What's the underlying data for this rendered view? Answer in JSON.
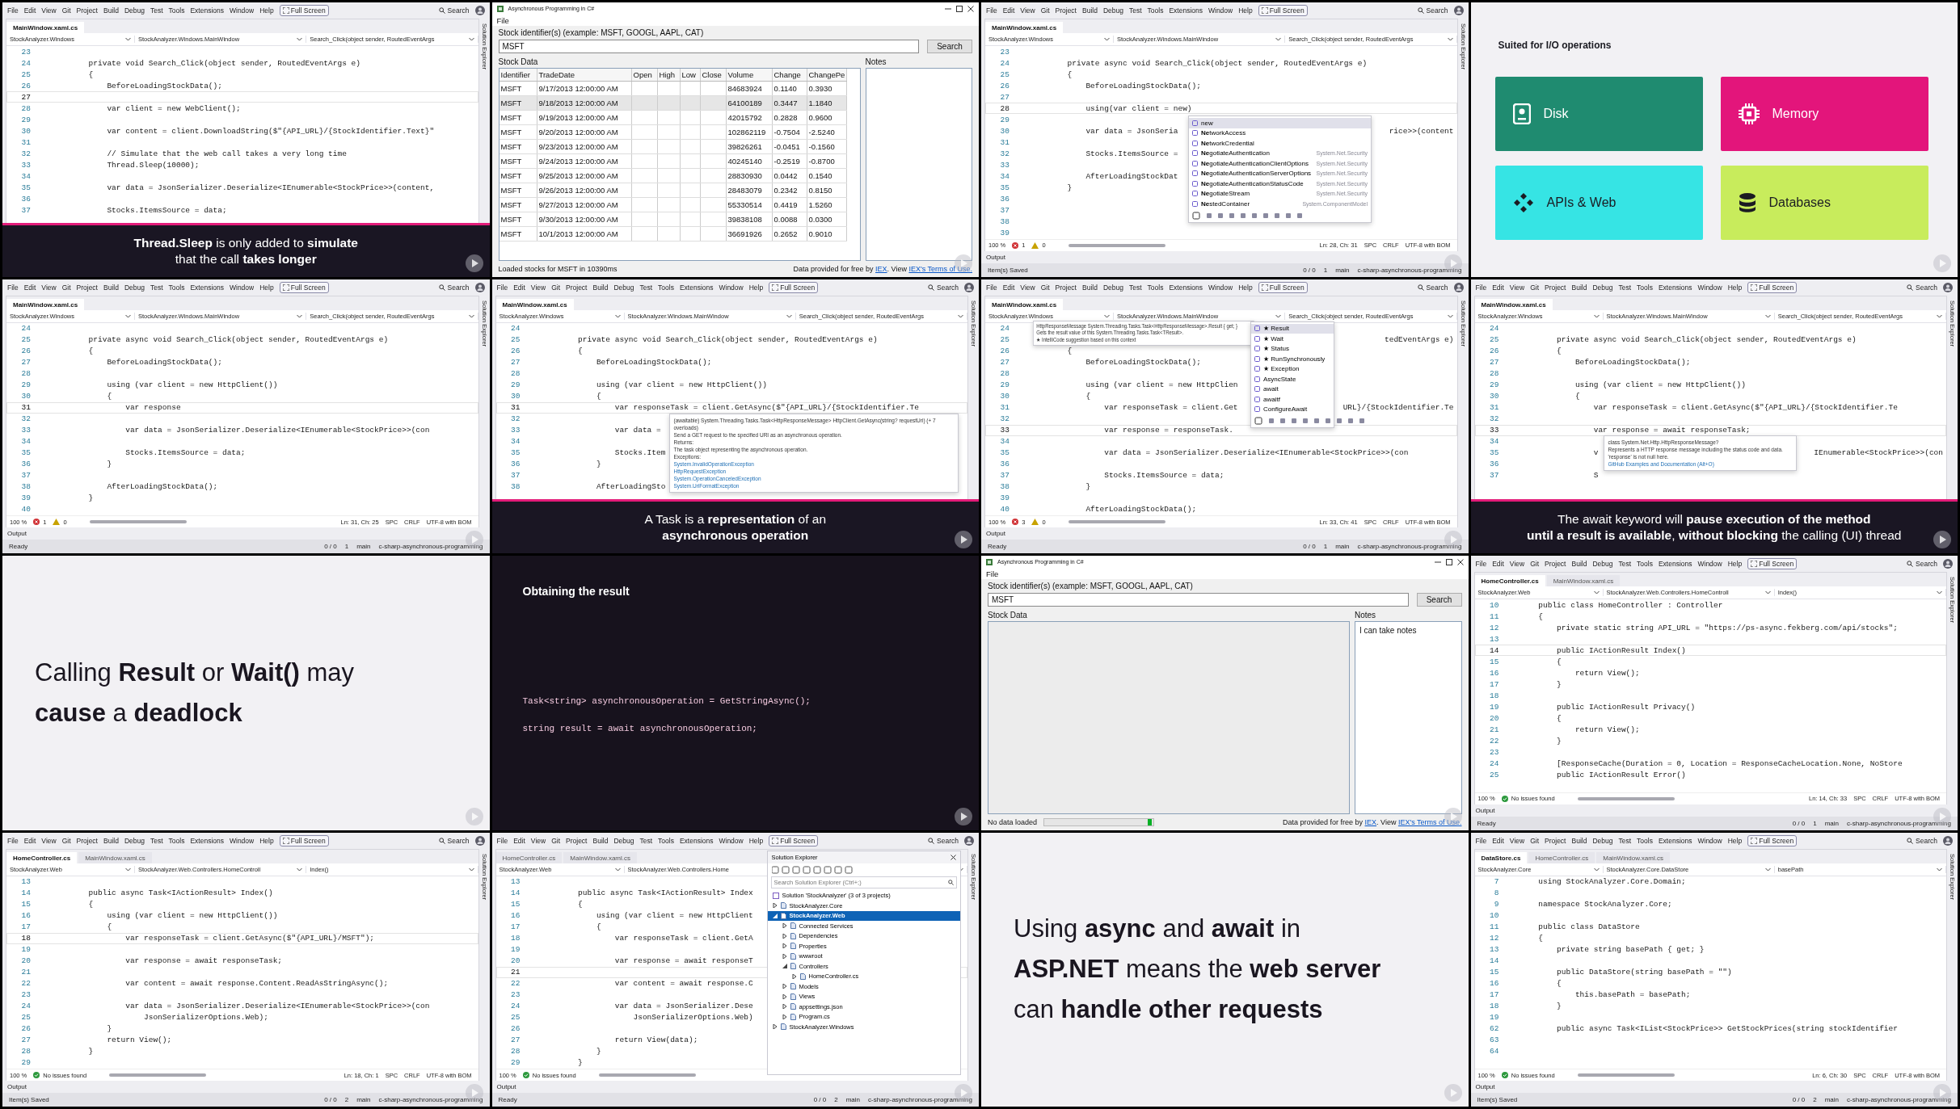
{
  "tiles": [
    {
      "kind": "ide",
      "menu": [
        "File",
        "Edit",
        "View",
        "Git",
        "Project",
        "Build",
        "Debug",
        "Test",
        "Tools",
        "Extensions",
        "Window",
        "Help"
      ],
      "fullscreen": "Full Screen",
      "search": "Search",
      "side_label": "Solution Explorer",
      "tabs": [
        {
          "label": "MainWindow.xaml.cs",
          "selected": true
        }
      ],
      "nav": [
        "StockAnalyzer.Windows",
        "StockAnalyzer.Windows.MainWindow",
        "Search_Click(object sender, RoutedEventArgs"
      ],
      "lines": [
        {
          "n": "23",
          "current": false
        },
        {
          "n": "24",
          "code": "        private void Search_Click(object sender, RoutedEventArgs e)",
          "current": false
        },
        {
          "n": "25",
          "code": "        {",
          "current": false
        },
        {
          "n": "26",
          "code": "            BeforeLoadingStockData();",
          "current": false
        },
        {
          "n": "27",
          "current": true
        },
        {
          "n": "28",
          "code": "            var client = new WebClient();",
          "current": false
        },
        {
          "n": "29",
          "current": false
        },
        {
          "n": "30",
          "code": "            var content = client.DownloadString($\"{API_URL}/{StockIdentifier.Text}\"",
          "current": false
        },
        {
          "n": "31",
          "current": false
        },
        {
          "n": "32",
          "code": "            // Simulate that the web call takes a very long time",
          "current": false
        },
        {
          "n": "33",
          "code": "            Thread.Sleep(10000);",
          "current": false
        },
        {
          "n": "34",
          "current": false
        },
        {
          "n": "35",
          "code": "            var data = JsonSerializer.Deserialize<IEnumerable<StockPrice>>(content,",
          "current": false
        },
        {
          "n": "36",
          "current": false
        },
        {
          "n": "37",
          "code": "            Stocks.ItemsSource = data;",
          "current": false
        }
      ],
      "caption": "**Thread.Sleep** is only added to **simulate**\nthat the call **takes longer**"
    },
    {
      "kind": "app",
      "title": "Asynchronous Programming in C#",
      "menu": "File",
      "prompt": "Stock identifier(s) (example: MSFT, GOOGL, AAPL, CAT)",
      "ticker": "MSFT",
      "search": "Search",
      "data_label": "Stock Data",
      "notes_label": "Notes",
      "columns": [
        "Identifier",
        "TradeDate",
        "Open",
        "High",
        "Low",
        "Close",
        "Volume",
        "Change",
        "ChangePe"
      ],
      "rows": [
        {
          "id": "MSFT",
          "date": "9/17/2013 12:00:00 AM",
          "volume": "84683924",
          "change": "0.1140",
          "pct": "0.3930",
          "selected": false
        },
        {
          "id": "MSFT",
          "date": "9/18/2013 12:00:00 AM",
          "volume": "64100189",
          "change": "0.3447",
          "pct": "1.1840",
          "selected": true
        },
        {
          "id": "MSFT",
          "date": "9/19/2013 12:00:00 AM",
          "volume": "42015792",
          "change": "0.2828",
          "pct": "0.9600",
          "selected": false
        },
        {
          "id": "MSFT",
          "date": "9/20/2013 12:00:00 AM",
          "volume": "102862119",
          "change": "-0.7504",
          "pct": "-2.5240",
          "selected": false
        },
        {
          "id": "MSFT",
          "date": "9/23/2013 12:00:00 AM",
          "volume": "39826261",
          "change": "-0.0451",
          "pct": "-0.1560",
          "selected": false
        },
        {
          "id": "MSFT",
          "date": "9/24/2013 12:00:00 AM",
          "volume": "40245140",
          "change": "-0.2519",
          "pct": "-0.8700",
          "selected": false
        },
        {
          "id": "MSFT",
          "date": "9/25/2013 12:00:00 AM",
          "volume": "28830930",
          "change": "0.0442",
          "pct": "0.1540",
          "selected": false
        },
        {
          "id": "MSFT",
          "date": "9/26/2013 12:00:00 AM",
          "volume": "28483079",
          "change": "0.2342",
          "pct": "0.8150",
          "selected": false
        },
        {
          "id": "MSFT",
          "date": "9/27/2013 12:00:00 AM",
          "volume": "55330514",
          "change": "0.4419",
          "pct": "1.5260",
          "selected": false
        },
        {
          "id": "MSFT",
          "date": "9/30/2013 12:00:00 AM",
          "volume": "39838108",
          "change": "0.0088",
          "pct": "0.0300",
          "selected": false
        },
        {
          "id": "MSFT",
          "date": "10/1/2013 12:00:00 AM",
          "volume": "36691926",
          "change": "0.2652",
          "pct": "0.9010",
          "selected": false
        }
      ],
      "status": "Loaded stocks for MSFT in 10390ms",
      "busy": false,
      "credit": [
        {
          "text": "Data provided for free by ",
          "kind": "text"
        },
        {
          "text": "IEX",
          "kind": "link"
        },
        {
          "text": ". View ",
          "kind": "text"
        },
        {
          "text": "IEX's Terms of Use.",
          "kind": "link"
        }
      ]
    },
    {
      "kind": "ide",
      "menu": [
        "File",
        "Edit",
        "View",
        "Git",
        "Project",
        "Build",
        "Debug",
        "Test",
        "Tools",
        "Extensions",
        "Window",
        "Help"
      ],
      "fullscreen": "Full Screen",
      "search": "Search",
      "side_label": "Solution Explorer",
      "tabs": [
        {
          "label": "MainWindow.xaml.cs",
          "selected": true
        }
      ],
      "nav": [
        "StockAnalyzer.Windows",
        "StockAnalyzer.Windows.MainWindow",
        "Search_Click(object sender, RoutedEventArgs"
      ],
      "lines": [
        {
          "n": "23",
          "current": false
        },
        {
          "n": "24",
          "code": "        private async void Search_Click(object sender, RoutedEventArgs e)",
          "current": false
        },
        {
          "n": "25",
          "code": "        {",
          "current": false
        },
        {
          "n": "26",
          "code": "            BeforeLoadingStockData();",
          "current": false
        },
        {
          "n": "27",
          "current": false
        },
        {
          "n": "28",
          "code": "            using(var client = new)",
          "current": true
        },
        {
          "n": "29",
          "current": false
        },
        {
          "n": "30",
          "code": "            var data = JsonSeria",
          "tail": "rice>>(content",
          "current": false
        },
        {
          "n": "31",
          "current": false
        },
        {
          "n": "32",
          "code": "            Stocks.ItemsSource =",
          "current": false
        },
        {
          "n": "33",
          "current": false
        },
        {
          "n": "34",
          "code": "            AfterLoadingStockDat",
          "current": false
        },
        {
          "n": "35",
          "code": "        }",
          "current": false
        },
        {
          "n": "36",
          "current": false
        },
        {
          "n": "37",
          "current": false
        },
        {
          "n": "38",
          "current": false
        },
        {
          "n": "39",
          "current": false
        }
      ],
      "popups": [
        {
          "kind": "completion",
          "items": [
            {
              "text": "new",
              "selected": true
            },
            {
              "text": "**Ne**tworkAccess",
              "selected": false
            },
            {
              "text": "**Ne**tworkCredential",
              "selected": false
            },
            {
              "text": "**Ne**gotiateAuthentication",
              "detail": "System.Net.Security",
              "selected": false
            },
            {
              "text": "**Ne**gotiateAuthenticationClientOptions",
              "detail": "System.Net.Security",
              "selected": false
            },
            {
              "text": "**Ne**gotiateAuthenticationServerOptions",
              "detail": "System.Net.Security",
              "selected": false
            },
            {
              "text": "**Ne**gotiateAuthenticationStatusCode",
              "detail": "System.Net.Security",
              "selected": false
            },
            {
              "text": "**Ne**gotiateStream",
              "detail": "System.Net.Security",
              "selected": false
            },
            {
              "text": "**Ne**stedContainer",
              "detail": "System.ComponentModel",
              "selected": false
            }
          ]
        }
      ],
      "status": {
        "zoom": "100 %",
        "issues": {
          "kind": "counts",
          "errors": "1",
          "warnings": "0"
        },
        "right": [
          "Ln: 28, Ch: 31",
          "SPC",
          "CRLF",
          "UTF-8 with BOM"
        ]
      },
      "output": "Output",
      "bottom": {
        "message": "Item(s) Saved",
        "items": [
          "0 / 0",
          "1",
          "main",
          "c-sharp-asynchronous-programming"
        ]
      }
    },
    {
      "kind": "cards",
      "title": "Suited for I/O operations",
      "cards": [
        {
          "label": "Disk",
          "color": "#1f8b70"
        },
        {
          "label": "Memory",
          "color": "#e3157b"
        },
        {
          "label": "APIs & Web",
          "color": "#36e4e4"
        },
        {
          "label": "Databases",
          "color": "#c8ec5c"
        }
      ]
    },
    {
      "kind": "ide",
      "menu": [
        "File",
        "Edit",
        "View",
        "Git",
        "Project",
        "Build",
        "Debug",
        "Test",
        "Tools",
        "Extensions",
        "Window",
        "Help"
      ],
      "fullscreen": "Full Screen",
      "search": "Search",
      "side_label": "Solution Explorer",
      "tabs": [
        {
          "label": "MainWindow.xaml.cs",
          "selected": true
        }
      ],
      "nav": [
        "StockAnalyzer.Windows",
        "StockAnalyzer.Windows.MainWindow",
        "Search_Click(object sender, RoutedEventArgs"
      ],
      "lines": [
        {
          "n": "24",
          "current": false
        },
        {
          "n": "25",
          "code": "        private async void Search_Click(object sender, RoutedEventArgs e)",
          "current": false
        },
        {
          "n": "26",
          "code": "        {",
          "current": false
        },
        {
          "n": "27",
          "code": "            BeforeLoadingStockData();",
          "current": false
        },
        {
          "n": "28",
          "current": false
        },
        {
          "n": "29",
          "code": "            using (var client = new HttpClient())",
          "current": false
        },
        {
          "n": "30",
          "code": "            {",
          "current": false
        },
        {
          "n": "31",
          "code": "                var response",
          "current": true
        },
        {
          "n": "32",
          "current": false
        },
        {
          "n": "33",
          "code": "                var data = JsonSerializer.Deserialize<IEnumerable<StockPrice>>(con",
          "current": false
        },
        {
          "n": "34",
          "current": false
        },
        {
          "n": "35",
          "code": "                Stocks.ItemsSource = data;",
          "current": false
        },
        {
          "n": "36",
          "code": "            }",
          "current": false
        },
        {
          "n": "37",
          "current": false
        },
        {
          "n": "38",
          "code": "            AfterLoadingStockData();",
          "current": false
        },
        {
          "n": "39",
          "code": "        }",
          "current": false
        },
        {
          "n": "40",
          "current": false
        }
      ],
      "status": {
        "zoom": "100 %",
        "issues": {
          "kind": "counts",
          "errors": "1",
          "warnings": "0"
        },
        "right": [
          "Ln: 31, Ch: 25",
          "SPC",
          "CRLF",
          "UTF-8 with BOM"
        ]
      },
      "output": "Output",
      "bottom": {
        "message": "Ready",
        "items": [
          "0 / 0",
          "1",
          "main",
          "c-sharp-asynchronous-programming"
        ]
      }
    },
    {
      "kind": "ide",
      "menu": [
        "File",
        "Edit",
        "View",
        "Git",
        "Project",
        "Build",
        "Debug",
        "Test",
        "Tools",
        "Extensions",
        "Window",
        "Help"
      ],
      "fullscreen": "Full Screen",
      "search": "Search",
      "side_label": "Solution Explorer",
      "tabs": [
        {
          "label": "MainWindow.xaml.cs",
          "selected": true
        }
      ],
      "nav": [
        "StockAnalyzer.Windows",
        "StockAnalyzer.Windows.MainWindow",
        "Search_Click(object sender, RoutedEventArgs"
      ],
      "lines": [
        {
          "n": "24",
          "current": false
        },
        {
          "n": "25",
          "code": "        private async void Search_Click(object sender, RoutedEventArgs e)",
          "current": false
        },
        {
          "n": "26",
          "code": "        {",
          "current": false
        },
        {
          "n": "27",
          "code": "            BeforeLoadingStockData();",
          "current": false
        },
        {
          "n": "28",
          "current": false
        },
        {
          "n": "29",
          "code": "            using (var client = new HttpClient())",
          "current": false
        },
        {
          "n": "30",
          "code": "            {",
          "current": false
        },
        {
          "n": "31",
          "code": "                var responseTask = client.GetAsync($\"{API_URL}/{StockIdentifier.Te",
          "current": true
        },
        {
          "n": "32",
          "current": false
        },
        {
          "n": "33",
          "code": "                var data =",
          "current": false
        },
        {
          "n": "34",
          "current": false
        },
        {
          "n": "35",
          "code": "                Stocks.Item",
          "current": false
        },
        {
          "n": "36",
          "code": "            }",
          "current": false
        },
        {
          "n": "37",
          "current": false
        },
        {
          "n": "38",
          "code": "            AfterLoadingSto",
          "current": false
        }
      ],
      "popups": [
        {
          "kind": "tooltip",
          "lines": [
            {
              "text": "(awaitable) System.Threading.Tasks.Task<HttpResponseMessage> HttpClient.GetAsync(string? requestUri) (+ 7 overloads)",
              "link": false
            },
            {
              "text": "Send a GET request to the specified URI as an asynchronous operation.",
              "link": false
            },
            {
              "text": "Returns:",
              "link": false
            },
            {
              "text": "The task object representing the asynchronous operation.",
              "link": false
            },
            {
              "text": "Exceptions:",
              "link": false
            },
            {
              "text": "System.InvalidOperationException",
              "link": true
            },
            {
              "text": "HttpRequestException",
              "link": true
            },
            {
              "text": "System.OperationCanceledException",
              "link": true
            },
            {
              "text": "System.UriFormatException",
              "link": true
            }
          ]
        }
      ],
      "caption": "A Task is a **representation** of an\n**asynchronous operation**"
    },
    {
      "kind": "ide",
      "menu": [
        "File",
        "Edit",
        "View",
        "Git",
        "Project",
        "Build",
        "Debug",
        "Test",
        "Tools",
        "Extensions",
        "Window",
        "Help"
      ],
      "fullscreen": "Full Screen",
      "search": "Search",
      "side_label": "Solution Explorer",
      "tabs": [
        {
          "label": "MainWindow.xaml.cs",
          "selected": true
        }
      ],
      "nav": [
        "StockAnalyzer.Windows",
        "StockAnalyzer.Windows.MainWindow",
        "Search_Click(object sender, RoutedEventArgs"
      ],
      "lines": [
        {
          "n": "24",
          "current": false
        },
        {
          "n": "25",
          "tail": "tedEventArgs e)",
          "current": false
        },
        {
          "n": "26",
          "code": "        {",
          "current": false
        },
        {
          "n": "27",
          "code": "            BeforeLoadingStockData();",
          "current": false
        },
        {
          "n": "28",
          "current": false
        },
        {
          "n": "29",
          "code": "            using (var client = new HttpClien",
          "current": false
        },
        {
          "n": "30",
          "code": "            {",
          "current": false
        },
        {
          "n": "31",
          "code": "                var responseTask = client.Get",
          "tail": "URL}/{StockIdentifier.Te",
          "current": false
        },
        {
          "n": "32",
          "current": false
        },
        {
          "n": "33",
          "code": "                var response = responseTask.",
          "current": true
        },
        {
          "n": "34",
          "current": false
        },
        {
          "n": "35",
          "code": "                var data = JsonSerializer.Deserialize<IEnumerable<StockPrice>>(con",
          "current": false
        },
        {
          "n": "36",
          "current": false
        },
        {
          "n": "37",
          "code": "                Stocks.ItemsSource = data;",
          "current": false
        },
        {
          "n": "38",
          "code": "            }",
          "current": false
        },
        {
          "n": "39",
          "current": false
        },
        {
          "n": "40",
          "code": "            AfterLoadingStockData();",
          "current": false
        }
      ],
      "popups": [
        {
          "kind": "tooltip",
          "lines": [
            {
              "text": "HttpResponseMessage System.Threading.Tasks.Task<HttpResponseMessage>.Result { get; }",
              "link": false
            },
            {
              "text": "Gets the result value of this System.Threading.Tasks.Task<TResult>.",
              "link": false
            },
            {
              "text": "★ IntelliCode suggestion based on this context",
              "link": false
            }
          ]
        },
        {
          "kind": "completion",
          "items": [
            {
              "text": "★ Result",
              "selected": true
            },
            {
              "text": "★ Wait",
              "selected": false
            },
            {
              "text": "★ Status",
              "selected": false
            },
            {
              "text": "★ RunSynchronously",
              "selected": false
            },
            {
              "text": "★ Exception",
              "selected": false
            },
            {
              "text": "AsyncState",
              "selected": false
            },
            {
              "text": "await",
              "selected": false
            },
            {
              "text": "awaitf",
              "selected": false
            },
            {
              "text": "ConfigureAwait",
              "selected": false
            }
          ]
        }
      ],
      "status": {
        "zoom": "100 %",
        "issues": {
          "kind": "counts",
          "errors": "3",
          "warnings": "0"
        },
        "right": [
          "Ln: 33, Ch: 41",
          "SPC",
          "CRLF",
          "UTF-8 with BOM"
        ]
      },
      "output": "Output",
      "bottom": {
        "message": "Ready",
        "items": [
          "0 / 0",
          "1",
          "main",
          "c-sharp-asynchronous-programming"
        ]
      }
    },
    {
      "kind": "ide",
      "menu": [
        "File",
        "Edit",
        "View",
        "Git",
        "Project",
        "Build",
        "Debug",
        "Test",
        "Tools",
        "Extensions",
        "Window",
        "Help"
      ],
      "fullscreen": "Full Screen",
      "search": "Search",
      "side_label": "Solution Explorer",
      "tabs": [
        {
          "label": "MainWindow.xaml.cs",
          "selected": true
        }
      ],
      "nav": [
        "StockAnalyzer.Windows",
        "StockAnalyzer.Windows.MainWindow",
        "Search_Click(object sender, RoutedEventArgs"
      ],
      "lines": [
        {
          "n": "24",
          "current": false
        },
        {
          "n": "25",
          "code": "        private async void Search_Click(object sender, RoutedEventArgs e)",
          "current": false
        },
        {
          "n": "26",
          "code": "        {",
          "current": false
        },
        {
          "n": "27",
          "code": "            BeforeLoadingStockData();",
          "current": false
        },
        {
          "n": "28",
          "current": false
        },
        {
          "n": "29",
          "code": "            using (var client = new HttpClient())",
          "current": false
        },
        {
          "n": "30",
          "code": "            {",
          "current": false
        },
        {
          "n": "31",
          "code": "                var responseTask = client.GetAsync($\"{API_URL}/{StockIdentifier.Te",
          "current": false
        },
        {
          "n": "32",
          "current": false
        },
        {
          "n": "33",
          "code": "                var response = await responseTask;",
          "current": true
        },
        {
          "n": "34",
          "current": false
        },
        {
          "n": "35",
          "code": "                v",
          "tail": "IEnumerable<StockPrice>>(con",
          "current": false
        },
        {
          "n": "36",
          "current": false
        },
        {
          "n": "37",
          "code": "                S",
          "current": false
        }
      ],
      "popups": [
        {
          "kind": "tooltip",
          "lines": [
            {
              "text": "class System.Net.Http.HttpResponseMessage?",
              "link": false
            },
            {
              "text": "Represents a HTTP response message including the status code and data.",
              "link": false
            },
            {
              "text": "'response' is not null here.",
              "link": false
            },
            {
              "text": "GitHub Examples and Documentation (Alt+O)",
              "link": true
            }
          ]
        }
      ],
      "caption": "The await keyword will **pause execution of the method**\n**until a result is available**, **without blocking** the calling (UI) thread"
    },
    {
      "kind": "statement",
      "text": "Calling **Result** or **Wait()** may\n**cause** a **deadlock**"
    },
    {
      "kind": "code_slide",
      "title": "Obtaining the result",
      "lines": [
        "Task<string> asynchronousOperation = GetStringAsync();",
        "string result = await asynchronousOperation;"
      ]
    },
    {
      "kind": "app",
      "title": "Asynchronous Programming in C#",
      "menu": "File",
      "prompt": "Stock identifier(s) (example: MSFT, GOOGL, AAPL, CAT)",
      "ticker": "MSFT",
      "search": "Search",
      "data_label": "Stock Data",
      "notes_label": "Notes",
      "notes": "I can take notes",
      "status": "No data loaded",
      "busy": true,
      "credit": [
        {
          "text": "Data provided for free by ",
          "kind": "text"
        },
        {
          "text": "IEX",
          "kind": "link"
        },
        {
          "text": ". View ",
          "kind": "text"
        },
        {
          "text": "IEX's Terms of Use.",
          "kind": "link"
        }
      ]
    },
    {
      "kind": "ide",
      "menu": [
        "File",
        "Edit",
        "View",
        "Git",
        "Project",
        "Build",
        "Debug",
        "Test",
        "Tools",
        "Extensions",
        "Window",
        "Help"
      ],
      "fullscreen": "Full Screen",
      "search": "Search",
      "side_label": "Solution Explorer",
      "tabs": [
        {
          "label": "HomeController.cs",
          "selected": true
        },
        {
          "label": "MainWindow.xaml.cs",
          "selected": false
        }
      ],
      "nav": [
        "StockAnalyzer.Web",
        "StockAnalyzer.Web.Controllers.HomeControll",
        "Index()"
      ],
      "lines": [
        {
          "n": "10",
          "code": "    public class HomeController : Controller",
          "current": false
        },
        {
          "n": "11",
          "code": "    {",
          "current": false
        },
        {
          "n": "12",
          "code": "        private static string API_URL = \"https://ps-async.fekberg.com/api/stocks\";",
          "current": false
        },
        {
          "n": "13",
          "current": false
        },
        {
          "n": "14",
          "code": "        public IActionResult Index()",
          "current": true
        },
        {
          "n": "15",
          "code": "        {",
          "current": false
        },
        {
          "n": "16",
          "code": "            return View();",
          "current": false
        },
        {
          "n": "17",
          "code": "        }",
          "current": false
        },
        {
          "n": "18",
          "current": false
        },
        {
          "n": "19",
          "code": "        public IActionResult Privacy()",
          "current": false
        },
        {
          "n": "20",
          "code": "        {",
          "current": false
        },
        {
          "n": "21",
          "code": "            return View();",
          "current": false
        },
        {
          "n": "22",
          "code": "        }",
          "current": false
        },
        {
          "n": "23",
          "current": false
        },
        {
          "n": "24",
          "code": "        [ResponseCache(Duration = 0, Location = ResponseCacheLocation.None, NoStore",
          "current": false
        },
        {
          "n": "25",
          "code": "        public IActionResult Error()",
          "current": false
        }
      ],
      "status": {
        "zoom": "100 %",
        "issues": {
          "kind": "clean",
          "text": "No issues found"
        },
        "right": [
          "Ln: 14, Ch: 33",
          "SPC",
          "CRLF",
          "UTF-8 with BOM"
        ]
      },
      "output": "Output",
      "bottom": {
        "message": "Ready",
        "items": [
          "0 / 0",
          "1",
          "main",
          "c-sharp-asynchronous-programming"
        ]
      }
    },
    {
      "kind": "ide",
      "menu": [
        "File",
        "Edit",
        "View",
        "Git",
        "Project",
        "Build",
        "Debug",
        "Test",
        "Tools",
        "Extensions",
        "Window",
        "Help"
      ],
      "fullscreen": "Full Screen",
      "search": "Search",
      "side_label": "Solution Explorer",
      "tabs": [
        {
          "label": "HomeController.cs",
          "selected": true
        },
        {
          "label": "MainWindow.xaml.cs",
          "selected": false
        }
      ],
      "nav": [
        "StockAnalyzer.Web",
        "StockAnalyzer.Web.Controllers.HomeControll",
        "Index()"
      ],
      "lines": [
        {
          "n": "13",
          "current": false
        },
        {
          "n": "14",
          "code": "        public async Task<IActionResult> Index()",
          "current": false
        },
        {
          "n": "15",
          "code": "        {",
          "current": false
        },
        {
          "n": "16",
          "code": "            using (var client = new HttpClient())",
          "current": false
        },
        {
          "n": "17",
          "code": "            {",
          "current": false
        },
        {
          "n": "18",
          "code": "                var responseTask = client.GetAsync($\"{API_URL}/MSFT\");",
          "current": true
        },
        {
          "n": "19",
          "current": false
        },
        {
          "n": "20",
          "code": "                var response = await responseTask;",
          "current": false
        },
        {
          "n": "21",
          "current": false
        },
        {
          "n": "22",
          "code": "                var content = await response.Content.ReadAsStringAsync();",
          "current": false
        },
        {
          "n": "23",
          "current": false
        },
        {
          "n": "24",
          "code": "                var data = JsonSerializer.Deserialize<IEnumerable<StockPrice>>(con",
          "current": false
        },
        {
          "n": "25",
          "code": "                    JsonSerializerOptions.Web);",
          "current": false
        },
        {
          "n": "26",
          "code": "            }",
          "current": false
        },
        {
          "n": "27",
          "code": "            return View();",
          "current": false
        },
        {
          "n": "28",
          "code": "        }",
          "current": false
        },
        {
          "n": "29",
          "current": false
        }
      ],
      "status": {
        "zoom": "100 %",
        "issues": {
          "kind": "clean",
          "text": "No issues found"
        },
        "right": [
          "Ln: 18, Ch: 1",
          "SPC",
          "CRLF",
          "UTF-8 with BOM"
        ]
      },
      "output": "Output",
      "bottom": {
        "message": "Item(s) Saved",
        "items": [
          "0 / 0",
          "2",
          "main",
          "c-sharp-asynchronous-programming"
        ]
      }
    },
    {
      "kind": "ide",
      "menu": [
        "File",
        "Edit",
        "View",
        "Git",
        "Project",
        "Build",
        "Debug",
        "Test",
        "Tools",
        "Extensions",
        "Window",
        "Help"
      ],
      "fullscreen": "Full Screen",
      "search": "Search",
      "side_label": "Solution Explorer",
      "tabs": [
        {
          "label": "HomeController.cs",
          "selected": false
        },
        {
          "label": "MainWindow.xaml.cs",
          "selected": false
        }
      ],
      "nav": [
        "StockAnalyzer.Web",
        "StockAnalyzer.Web.Controllers.Home"
      ],
      "lines": [
        {
          "n": "13",
          "current": false
        },
        {
          "n": "14",
          "code": "        public async Task<IActionResult> Index",
          "current": false
        },
        {
          "n": "15",
          "code": "        {",
          "current": false
        },
        {
          "n": "16",
          "code": "            using (var client = new HttpClient",
          "current": false
        },
        {
          "n": "17",
          "code": "            {",
          "current": false
        },
        {
          "n": "18",
          "code": "                var responseTask = client.GetA",
          "current": false
        },
        {
          "n": "19",
          "current": false
        },
        {
          "n": "20",
          "code": "                var response = await responseT",
          "current": false
        },
        {
          "n": "21",
          "current": true
        },
        {
          "n": "22",
          "code": "                var content = await response.C",
          "current": false
        },
        {
          "n": "23",
          "current": false
        },
        {
          "n": "24",
          "code": "                var data = JsonSerializer.Dese",
          "current": false
        },
        {
          "n": "25",
          "code": "                    JsonSerializerOptions.Web)",
          "current": false
        },
        {
          "n": "26",
          "current": false
        },
        {
          "n": "27",
          "code": "                return View(data);",
          "current": false
        },
        {
          "n": "28",
          "code": "            }",
          "current": false
        },
        {
          "n": "29",
          "code": "        }",
          "current": false
        }
      ],
      "explorer": {
        "title": "Solution Explorer",
        "placeholder": "Search Solution Explorer (Ctrl+;)",
        "root": "Solution 'StockAnalyzer' (3 of 3 projects)",
        "tree": [
          {
            "label": "StockAnalyzer.Core",
            "expanded": false,
            "selected": false
          },
          {
            "label": "StockAnalyzer.Web",
            "expanded": true,
            "selected": true,
            "children": [
              {
                "label": "Connected Services",
                "expanded": false,
                "selected": false
              },
              {
                "label": "Dependencies",
                "expanded": false,
                "selected": false
              },
              {
                "label": "Properties",
                "expanded": false,
                "selected": false
              },
              {
                "label": "wwwroot",
                "expanded": false,
                "selected": false
              },
              {
                "label": "Controllers",
                "expanded": true,
                "selected": false,
                "children": [
                  {
                    "label": "HomeController.cs",
                    "expanded": false,
                    "selected": false
                  }
                ]
              },
              {
                "label": "Models",
                "expanded": false,
                "selected": false
              },
              {
                "label": "Views",
                "expanded": false,
                "selected": false
              },
              {
                "label": "appsettings.json",
                "expanded": false,
                "selected": false
              },
              {
                "label": "Program.cs",
                "expanded": false,
                "selected": false
              }
            ]
          },
          {
            "label": "StockAnalyzer.Windows",
            "expanded": false,
            "selected": false
          }
        ]
      },
      "status": {
        "zoom": "100 %",
        "issues": {
          "kind": "clean",
          "text": "No issues found"
        }
      },
      "output": "Output",
      "bottom": {
        "message": "Ready",
        "items": [
          "0 / 0",
          "2",
          "main",
          "c-sharp-asynchronous-programming"
        ]
      }
    },
    {
      "kind": "statement",
      "text": "Using **async** and **await** in\n**ASP.NET** means the **web server**\ncan **handle other requests**"
    },
    {
      "kind": "ide",
      "menu": [
        "File",
        "Edit",
        "View",
        "Git",
        "Project",
        "Build",
        "Debug",
        "Test",
        "Tools",
        "Extensions",
        "Window",
        "Help"
      ],
      "fullscreen": "Full Screen",
      "search": "Search",
      "side_label": "Solution Explorer",
      "tabs": [
        {
          "label": "DataStore.cs",
          "selected": true
        },
        {
          "label": "HomeController.cs",
          "selected": false
        },
        {
          "label": "MainWindow.xaml.cs",
          "selected": false
        }
      ],
      "nav": [
        "StockAnalyzer.Core",
        "StockAnalyzer.Core.DataStore",
        "basePath"
      ],
      "lines": [
        {
          "n": "7",
          "code": "    using StockAnalyzer.Core.Domain;",
          "current": false
        },
        {
          "n": "8",
          "current": false
        },
        {
          "n": "9",
          "code": "    namespace StockAnalyzer.Core;",
          "current": false
        },
        {
          "n": "10",
          "current": false
        },
        {
          "n": "11",
          "code": "    public class DataStore",
          "current": false
        },
        {
          "n": "12",
          "code": "    {",
          "current": false
        },
        {
          "n": "13",
          "code": "        private string basePath { get; }",
          "current": false
        },
        {
          "n": "14",
          "current": false
        },
        {
          "n": "15",
          "code": "        public DataStore(string basePath = \"\")",
          "current": false
        },
        {
          "n": "16",
          "code": "        {",
          "current": false
        },
        {
          "n": "17",
          "code": "            this.basePath = basePath;",
          "current": false
        },
        {
          "n": "18",
          "code": "        }",
          "current": false
        },
        {
          "n": "19",
          "current": false
        },
        {
          "n": "62",
          "code": "        public async Task<IList<StockPrice>> GetStockPrices(string stockIdentifier",
          "current": false
        },
        {
          "n": "63",
          "current": false
        },
        {
          "n": "64",
          "current": false
        }
      ],
      "status": {
        "zoom": "100 %",
        "issues": {
          "kind": "clean",
          "text": "No issues found"
        },
        "right": [
          "Ln: 6, Ch: 30",
          "SPC",
          "CRLF",
          "UTF-8 with BOM"
        ]
      },
      "output": "Output",
      "bottom": {
        "message": "Item(s) Saved",
        "items": [
          "0 / 0",
          "2",
          "main",
          "c-sharp-asynchronous-programming"
        ]
      }
    }
  ]
}
